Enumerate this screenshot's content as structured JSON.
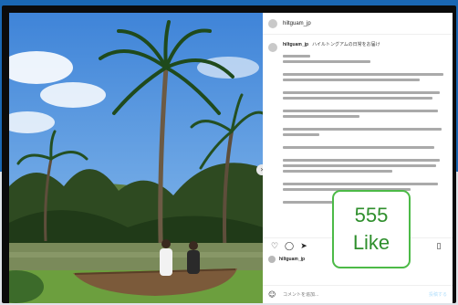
{
  "post": {
    "username": "hiltguam_jp",
    "caption_first_line": "ハイルトングアムの日常をお届け"
  },
  "photo": {
    "next_icon": "chevron-right-icon"
  },
  "actions": {
    "like_icon": "heart-icon",
    "comment_icon": "comment-icon",
    "share_icon": "send-icon",
    "save_icon": "bookmark-icon"
  },
  "comment": {
    "placeholder": "コメントを追加...",
    "post_label": "投稿する",
    "emoji_icon": "smile-icon"
  },
  "callout": {
    "count": "555",
    "label": "Like"
  }
}
